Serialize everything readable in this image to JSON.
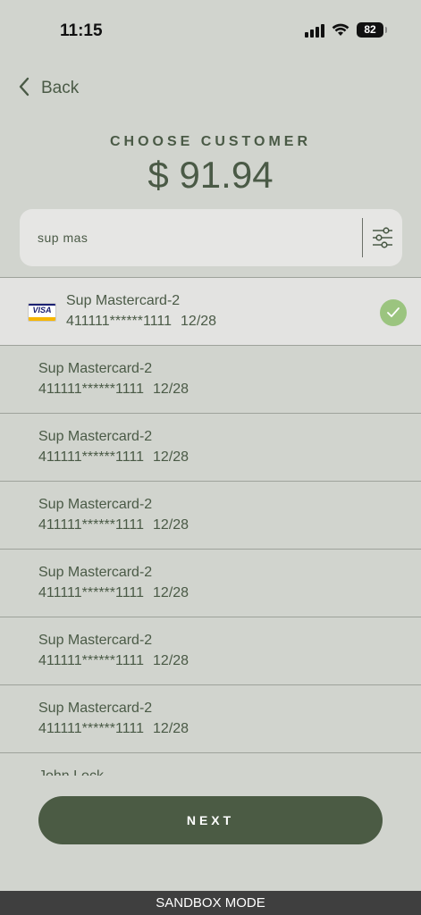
{
  "status_bar": {
    "time": "11:15",
    "battery": "82",
    "icons": [
      "signal-icon",
      "wifi-icon",
      "battery-icon"
    ]
  },
  "nav": {
    "back_label": "Back",
    "back_icon": "chevron-left-icon"
  },
  "header": {
    "title": "CHOOSE CUSTOMER",
    "amount": "$ 91.94"
  },
  "search": {
    "value": "sup mas",
    "filter_icon": "sliders-icon"
  },
  "customers": [
    {
      "name": "Sup Mastercard-2",
      "card": "411111******1111",
      "exp": "12/28",
      "selected": true,
      "card_brand": "VISA"
    },
    {
      "name": "Sup Mastercard-2",
      "card": "411111******1111",
      "exp": "12/28"
    },
    {
      "name": "Sup Mastercard-2",
      "card": "411111******1111",
      "exp": "12/28"
    },
    {
      "name": "Sup Mastercard-2",
      "card": "411111******1111",
      "exp": "12/28"
    },
    {
      "name": "Sup Mastercard-2",
      "card": "411111******1111",
      "exp": "12/28"
    },
    {
      "name": "Sup Mastercard-2",
      "card": "411111******1111",
      "exp": "12/28"
    },
    {
      "name": "Sup Mastercard-2",
      "card": "411111******1111",
      "exp": "12/28"
    },
    {
      "name": "John Lock",
      "card": "",
      "exp": ""
    }
  ],
  "footer": {
    "next_label": "NEXT",
    "sandbox_label": "SANDBOX MODE"
  },
  "colors": {
    "background": "#d1d4ce",
    "accent": "#4b5b44",
    "text": "#4a5a46",
    "check": "#9bc47f"
  }
}
